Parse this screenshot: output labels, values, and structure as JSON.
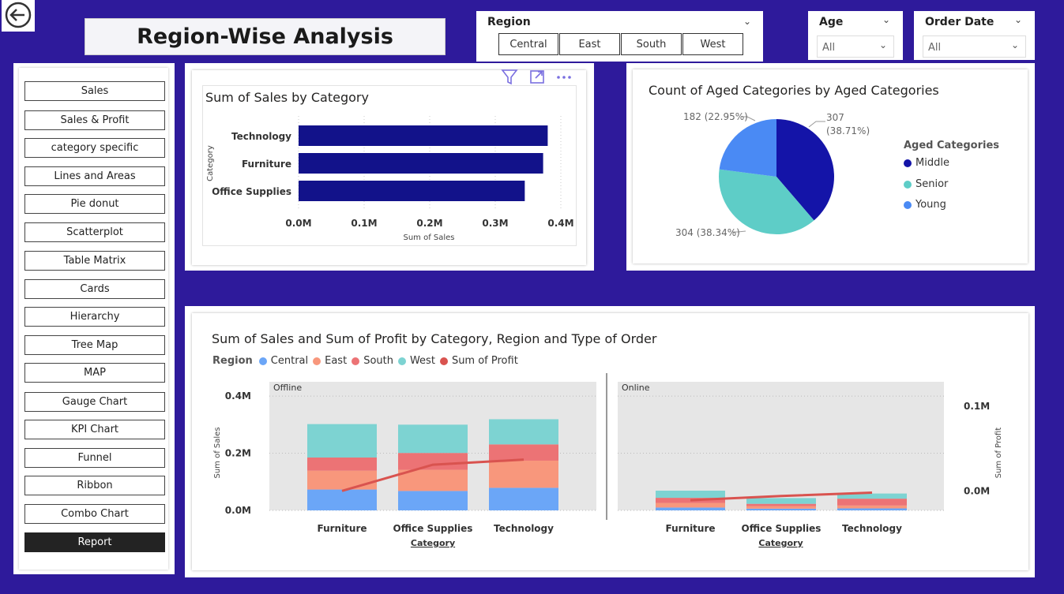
{
  "page": {
    "title": "Region-Wise Analysis"
  },
  "region_slicer": {
    "label": "Region",
    "options": [
      "Central",
      "East",
      "South",
      "West"
    ]
  },
  "age_slicer": {
    "label": "Age",
    "value": "All"
  },
  "date_slicer": {
    "label": "Order Date",
    "value": "All"
  },
  "nav": {
    "items": [
      "Sales",
      "Sales & Profit",
      "category specific",
      "Lines and Areas",
      "Pie donut",
      "Scatterplot",
      "Table Matrix",
      "Cards",
      "Hierarchy",
      "Tree Map",
      "MAP",
      "Gauge Chart",
      "KPI Chart",
      "Funnel",
      "Ribbon",
      "Combo Chart",
      "Report"
    ],
    "active": "Report"
  },
  "colors": {
    "background": "#2e1a9b",
    "bar_navy": "#12128a",
    "central": "#6ba6f7",
    "east": "#f8977c",
    "south": "#ec7375",
    "west": "#7dd3d2",
    "profit": "#d9534f",
    "middle": "#1414a8",
    "senior": "#5ecdc7",
    "young": "#4a8af4"
  },
  "chart_data": [
    {
      "type": "bar",
      "orientation": "horizontal",
      "title": "Sum of Sales by Category",
      "xlabel": "Sum of Sales",
      "ylabel": "Category",
      "categories": [
        "Technology",
        "Furniture",
        "Office Supplies"
      ],
      "values": [
        380000,
        373000,
        345000
      ],
      "xticks": [
        "0.0M",
        "0.1M",
        "0.2M",
        "0.3M",
        "0.4M"
      ],
      "xlim": [
        0,
        400000
      ]
    },
    {
      "type": "pie",
      "title": "Count of Aged Categories by Aged Categories",
      "legend_title": "Aged Categories",
      "labels": [
        "Middle",
        "Senior",
        "Young"
      ],
      "values": [
        307,
        304,
        182
      ],
      "data_labels": [
        "307 (38.71%)",
        "304 (38.34%)",
        "182 (22.95%)"
      ],
      "legend": "right"
    },
    {
      "type": "bar",
      "stacked": true,
      "title": "Sum of Sales and Sum of Profit by Category, Region and Type of Order",
      "legend_title": "Region",
      "legend": [
        "Central",
        "East",
        "South",
        "West",
        "Sum of Profit"
      ],
      "xlabel": "Category",
      "ylabel": "Sum of Sales",
      "y2label": "Sum of Profit",
      "yticks": [
        "0.0M",
        "0.2M",
        "0.4M"
      ],
      "y2ticks": [
        "0.0M",
        "0.1M"
      ],
      "ylim": [
        0,
        0.45
      ],
      "y2lim": [
        -0.023,
        0.129
      ],
      "panels": [
        {
          "name": "Offline",
          "categories": [
            "Furniture",
            "Office Supplies",
            "Technology"
          ],
          "series": [
            {
              "name": "Central",
              "values": [
                0.073,
                0.068,
                0.079
              ]
            },
            {
              "name": "East",
              "values": [
                0.066,
                0.074,
                0.095
              ]
            },
            {
              "name": "South",
              "values": [
                0.046,
                0.059,
                0.057
              ]
            },
            {
              "name": "West",
              "values": [
                0.117,
                0.099,
                0.088
              ]
            },
            {
              "name": "Sum of Profit",
              "values": [
                0.0,
                0.031,
                0.037
              ]
            }
          ]
        },
        {
          "name": "Online",
          "categories": [
            "Furniture",
            "Office Supplies",
            "Technology"
          ],
          "series": [
            {
              "name": "Central",
              "values": [
                0.01,
                0.006,
                0.007
              ]
            },
            {
              "name": "East",
              "values": [
                0.016,
                0.009,
                0.01
              ]
            },
            {
              "name": "South",
              "values": [
                0.018,
                0.008,
                0.024
              ]
            },
            {
              "name": "West",
              "values": [
                0.025,
                0.02,
                0.018
              ]
            },
            {
              "name": "Sum of Profit",
              "values": [
                -0.011,
                -0.006,
                -0.002
              ]
            }
          ]
        }
      ]
    }
  ]
}
